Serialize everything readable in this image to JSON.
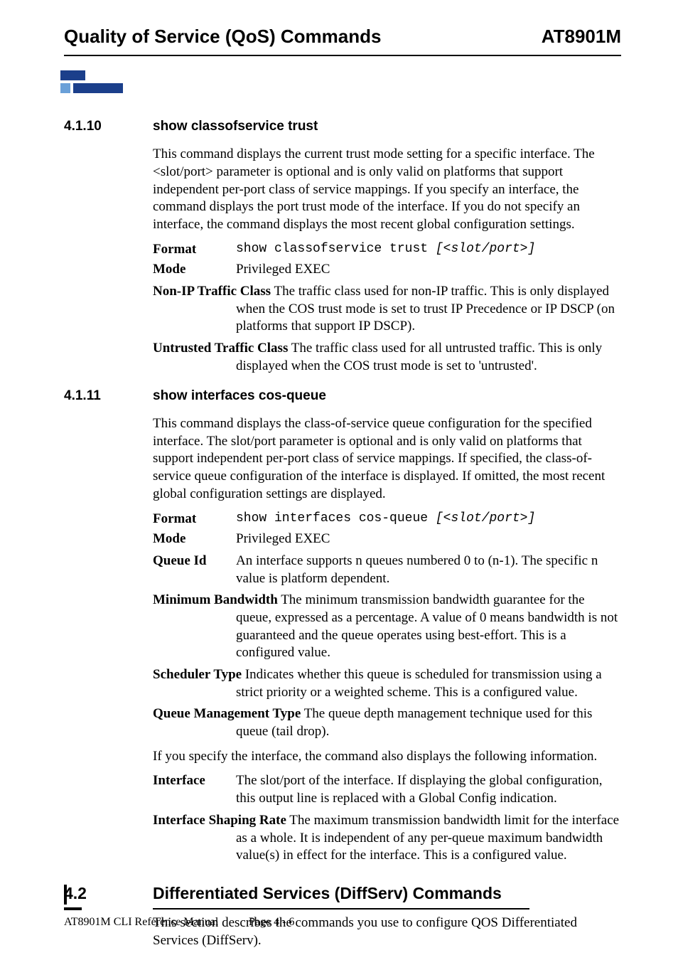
{
  "header": {
    "left": "Quality of Service (QoS) Commands",
    "right": "AT8901M"
  },
  "s4110": {
    "num": "4.1.10",
    "title": "show classofservice trust",
    "intro": "This command displays the current trust mode setting for a specific interface. The <slot/port> parameter is optional and is only valid on platforms that support independent per-port class of service mappings. If you specify an interface, the command displays the port trust mode of the interface. If you do not specify an interface, the command displays the most recent global configuration settings.",
    "format_label": "Format",
    "format_cmd": "show classofservice trust ",
    "format_arg": "[<slot/port>]",
    "mode_label": "Mode",
    "mode_val": "Privileged EXEC",
    "nonip_label": "Non-IP Traffic Class",
    "nonip_first": "  The traffic class used for non-IP traffic. This is only displayed",
    "nonip_rest": "when the COS trust mode is set to trust IP Precedence or IP DSCP (on platforms that support IP DSCP).",
    "untr_label": "Untrusted Traffic Class",
    "untr_first": "  The traffic class used for all untrusted traffic. This is only",
    "untr_rest": "displayed when the COS trust mode is set to 'untrusted'."
  },
  "s4111": {
    "num": "4.1.11",
    "title": "show interfaces cos-queue",
    "intro": "This command displays the class-of-service queue configuration for the specified interface. The slot/port parameter is optional and is only valid on platforms that support independent per-port class of service mappings. If specified, the class-of-service queue configuration of the interface is displayed. If omitted, the most recent global configuration settings are displayed.",
    "format_label": "Format",
    "format_cmd": "show interfaces cos-queue ",
    "format_arg": "[<slot/port>]",
    "mode_label": "Mode",
    "mode_val": "Privileged EXEC",
    "qid_label": "Queue Id",
    "qid_val": "An interface supports n queues numbered 0 to (n-1). The specific n value is platform dependent.",
    "minbw_label": "Minimum Bandwidth",
    "minbw_first": "  The minimum transmission bandwidth guarantee for the",
    "minbw_rest": "queue, expressed as a percentage. A value of 0 means bandwidth is not guaranteed and the queue operates using best-effort. This is a configured value.",
    "sched_label": "Scheduler Type",
    "sched_first": "  Indicates whether this queue is scheduled for transmission using a",
    "sched_rest": "strict priority or a weighted scheme. This is a configured value.",
    "qmt_label": "Queue Management Type",
    "qmt_first": "  The queue depth management technique used for this",
    "qmt_rest": "queue (tail drop).",
    "extra": "If you specify the interface, the command also displays the following information.",
    "iface_label": "Interface",
    "iface_val": "The slot/port of the interface. If displaying the global configuration, this output line is replaced with a Global Config indication.",
    "shape_label": "Interface Shaping Rate",
    "shape_first": "  The maximum transmission bandwidth limit for the interface",
    "shape_rest": "as a whole. It is independent of any per-queue maximum bandwidth value(s) in effect for the interface. This is a configured value."
  },
  "s42": {
    "num": "4.2",
    "title": "Differentiated Services (DiffServ) Commands",
    "intro": "This section describes the commands you use to configure QOS Differentiated Services (DiffServ)."
  },
  "footer": {
    "left": "AT8901M CLI Reference Manual",
    "center": "Page 4 - 6"
  }
}
